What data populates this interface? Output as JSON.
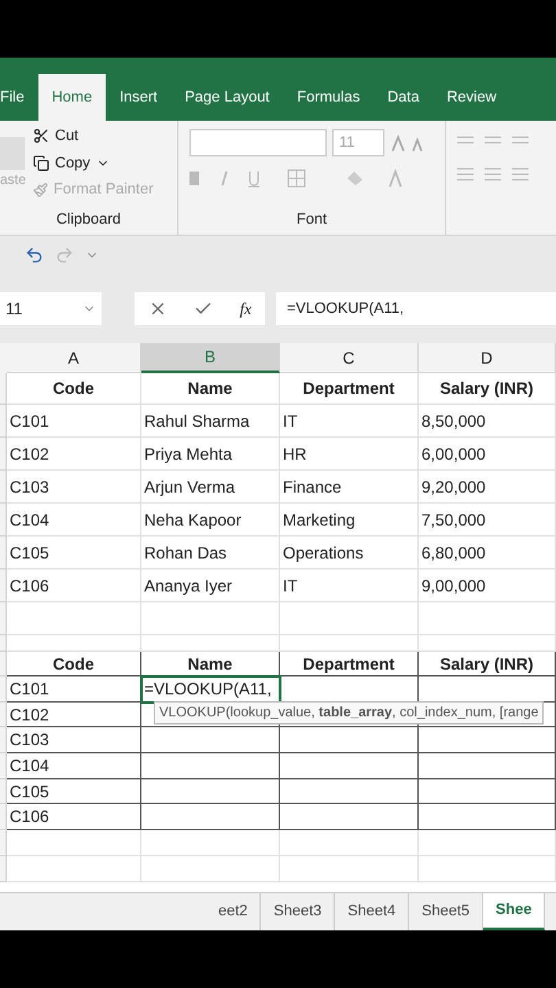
{
  "ribbon_tabs": [
    {
      "label": "File",
      "selected": false
    },
    {
      "label": "Home",
      "selected": true
    },
    {
      "label": "Insert",
      "selected": false
    },
    {
      "label": "Page Layout",
      "selected": false
    },
    {
      "label": "Formulas",
      "selected": false
    },
    {
      "label": "Data",
      "selected": false
    },
    {
      "label": "Review",
      "selected": false
    }
  ],
  "clipboard": {
    "paste": "aste",
    "cut": "Cut",
    "copy": "Copy",
    "format_painter": "Format Painter",
    "label": "Clipboard"
  },
  "font_group": {
    "size": "11",
    "label": "Font"
  },
  "name_box": "11",
  "formula": "=VLOOKUP(A11,",
  "fx": "fx",
  "columns": [
    {
      "label": "A",
      "selected": false
    },
    {
      "label": "B",
      "selected": true
    },
    {
      "label": "C",
      "selected": false
    },
    {
      "label": "D",
      "selected": false
    }
  ],
  "table1": {
    "headers": [
      "Code",
      "Name",
      "Department",
      "Salary (INR)"
    ],
    "rows": [
      [
        "C101",
        "Rahul Sharma",
        "IT",
        "8,50,000"
      ],
      [
        "C102",
        "Priya Mehta",
        "HR",
        "6,00,000"
      ],
      [
        "C103",
        "Arjun Verma",
        "Finance",
        "9,20,000"
      ],
      [
        "C104",
        "Neha Kapoor",
        "Marketing",
        "7,50,000"
      ],
      [
        "C105",
        "Rohan Das",
        "Operations",
        "6,80,000"
      ],
      [
        "C106",
        "Ananya Iyer",
        "IT",
        "9,00,000"
      ]
    ]
  },
  "table2": {
    "headers": [
      "Code",
      "Name",
      "Department",
      "Salary (INR)"
    ],
    "rows": [
      [
        "C101",
        "=VLOOKUP(A11,"
      ],
      [
        "C102"
      ],
      [
        "C103"
      ],
      [
        "C104"
      ],
      [
        "C105"
      ],
      [
        "C106"
      ]
    ]
  },
  "tooltip": "VLOOKUP(lookup_value, **table_array**, col_index_num, [range",
  "sheet_tabs": [
    {
      "label": "eet2",
      "selected": false
    },
    {
      "label": "Sheet3",
      "selected": false
    },
    {
      "label": "Sheet4",
      "selected": false
    },
    {
      "label": "Sheet5",
      "selected": false
    },
    {
      "label": "Shee",
      "selected": true
    }
  ]
}
